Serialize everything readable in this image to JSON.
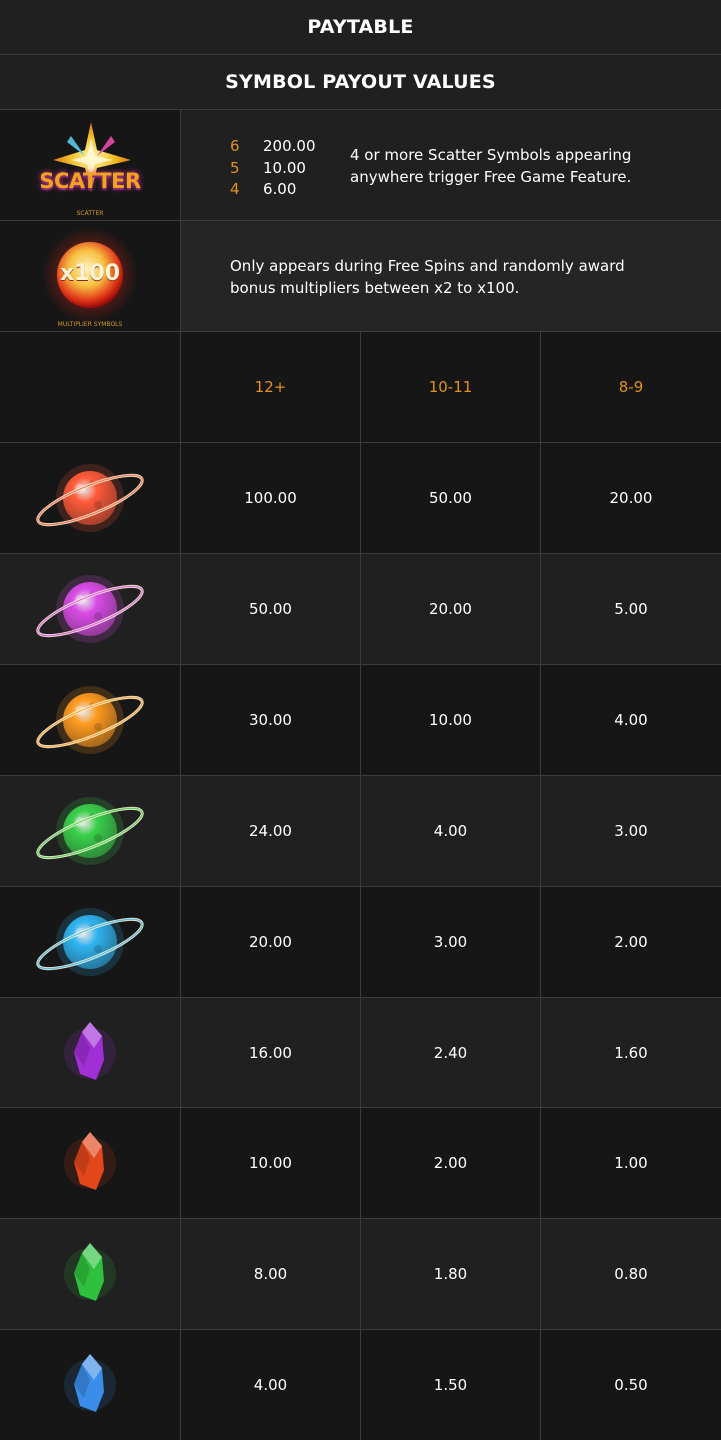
{
  "title": "PAYTABLE",
  "subtitle": "SYMBOL PAYOUT VALUES",
  "scatter": {
    "logo_text": "SCATTER",
    "caption": "SCATTER",
    "payouts": [
      {
        "count": "6",
        "value": "200.00"
      },
      {
        "count": "5",
        "value": "10.00"
      },
      {
        "count": "4",
        "value": "6.00"
      }
    ],
    "description_line1": "4 or more Scatter Symbols appearing",
    "description_line2": "anywhere trigger Free Game Feature."
  },
  "multiplier": {
    "orb_text": "x100",
    "caption": "MULTIPLIER SYMBOLS",
    "description_line1": "Only appears during Free Spins and randomly award",
    "description_line2": "bonus multipliers between x2 to x100."
  },
  "columns": [
    "12+",
    "10-11",
    "8-9"
  ],
  "symbols": [
    {
      "icon": "red-planet-icon",
      "color": "#ff5a3a",
      "values": [
        "100.00",
        "50.00",
        "20.00"
      ]
    },
    {
      "icon": "purple-planet-icon",
      "color": "#d94be6",
      "values": [
        "50.00",
        "20.00",
        "5.00"
      ]
    },
    {
      "icon": "orange-planet-icon",
      "color": "#ff9a1f",
      "values": [
        "30.00",
        "10.00",
        "4.00"
      ]
    },
    {
      "icon": "green-planet-icon",
      "color": "#39d04a",
      "values": [
        "24.00",
        "4.00",
        "3.00"
      ]
    },
    {
      "icon": "blue-planet-icon",
      "color": "#2fb4f0",
      "values": [
        "20.00",
        "3.00",
        "2.00"
      ]
    },
    {
      "icon": "purple-crystal-icon",
      "color": "#a12fd6",
      "values": [
        "16.00",
        "2.40",
        "1.60"
      ]
    },
    {
      "icon": "red-crystal-icon",
      "color": "#e2461b",
      "values": [
        "10.00",
        "2.00",
        "1.00"
      ]
    },
    {
      "icon": "green-crystal-icon",
      "color": "#2fc13d",
      "values": [
        "8.00",
        "1.80",
        "0.80"
      ]
    },
    {
      "icon": "blue-crystal-icon",
      "color": "#3a8de8",
      "values": [
        "4.00",
        "1.50",
        "0.50"
      ]
    }
  ]
}
